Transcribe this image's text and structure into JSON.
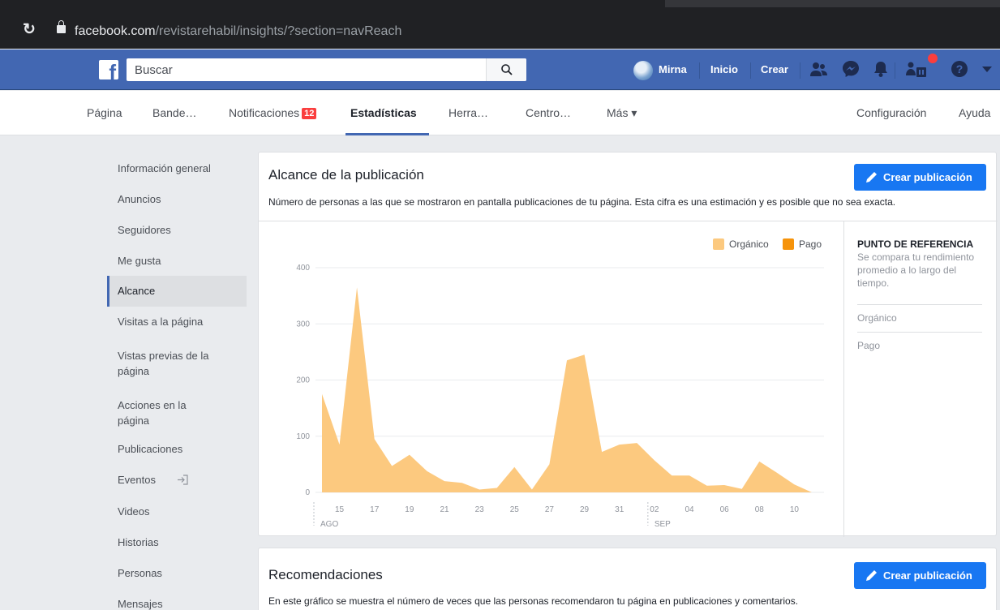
{
  "browser": {
    "url_host": "facebook.com",
    "url_path": "/revistarehabil/insights/?section=navReach"
  },
  "topbar": {
    "search_placeholder": "Buscar",
    "user_name": "Mirna",
    "home_label": "Inicio",
    "create_label": "Crear"
  },
  "page_tabs": [
    {
      "label": "Página"
    },
    {
      "label": "Bande…"
    },
    {
      "label": "Notificaciones",
      "badge": "12"
    },
    {
      "label": "Estadísticas"
    },
    {
      "label": "Herra…"
    },
    {
      "label": "Centro…"
    },
    {
      "label": "Más ▾"
    },
    {
      "label": "Configuración"
    },
    {
      "label": "Ayuda"
    }
  ],
  "sidebar": {
    "items": [
      {
        "label": "Información general"
      },
      {
        "label": "Anuncios"
      },
      {
        "label": "Seguidores"
      },
      {
        "label": "Me gusta"
      },
      {
        "label": "Alcance"
      },
      {
        "label": "Visitas a la página"
      },
      {
        "label": "Vistas previas de la página"
      },
      {
        "label": "Acciones en la página"
      },
      {
        "label": "Publicaciones"
      },
      {
        "label": "Eventos"
      },
      {
        "label": "Videos"
      },
      {
        "label": "Historias"
      },
      {
        "label": "Personas"
      },
      {
        "label": "Mensajes"
      }
    ]
  },
  "reach_card": {
    "title": "Alcance de la publicación",
    "description": "Número de personas a las que se mostraron en pantalla publicaciones de tu página. Esta cifra es una estimación y es posible que no sea exacta.",
    "create_button": "Crear publicación",
    "benchmark": {
      "title": "PUNTO DE REFERENCIA",
      "text": "Se compara tu rendimiento promedio a lo largo del tiempo.",
      "organic_label": "Orgánico",
      "paid_label": "Pago"
    }
  },
  "recommendations_card": {
    "title": "Recomendaciones",
    "description": "En este gráfico se muestra el número de veces que las personas recomendaron tu página en publicaciones y comentarios.",
    "create_button": "Crear publicación"
  },
  "colors": {
    "organic": "#fcc97f",
    "paid": "#f6930a",
    "accent": "#4267b2",
    "button": "#1877f2"
  },
  "chart_data": {
    "type": "area",
    "series": [
      {
        "name": "Orgánico",
        "color": "#fcc97f",
        "values": [
          175,
          85,
          365,
          95,
          47,
          67,
          38,
          20,
          17,
          5,
          8,
          45,
          5,
          50,
          235,
          245,
          72,
          85,
          88,
          57,
          30,
          30,
          12,
          13,
          6,
          55,
          35,
          14,
          0
        ]
      },
      {
        "name": "Pago",
        "color": "#f6930a",
        "values": [
          0,
          0,
          0,
          0,
          0,
          0,
          0,
          0,
          0,
          0,
          0,
          0,
          0,
          0,
          0,
          0,
          0,
          0,
          0,
          0,
          0,
          0,
          0,
          0,
          0,
          0,
          0,
          0,
          0
        ]
      }
    ],
    "x": [
      "14 ago",
      "15 ago",
      "16 ago",
      "17 ago",
      "18 ago",
      "19 ago",
      "20 ago",
      "21 ago",
      "22 ago",
      "23 ago",
      "24 ago",
      "25 ago",
      "26 ago",
      "27 ago",
      "28 ago",
      "29 ago",
      "30 ago",
      "31 ago",
      "01 sep",
      "02 sep",
      "03 sep",
      "04 sep",
      "05 sep",
      "06 sep",
      "07 sep",
      "08 sep",
      "09 sep",
      "10 sep",
      "11 sep"
    ],
    "x_ticks": [
      "15",
      "17",
      "19",
      "21",
      "23",
      "25",
      "27",
      "29",
      "31",
      "02",
      "04",
      "06",
      "08",
      "10"
    ],
    "month_labels": [
      "AGO",
      "SEP"
    ],
    "y_ticks": [
      "0",
      "100",
      "200",
      "300",
      "400"
    ],
    "ylim": [
      0,
      400
    ],
    "legend": "top-right",
    "grid": true
  }
}
